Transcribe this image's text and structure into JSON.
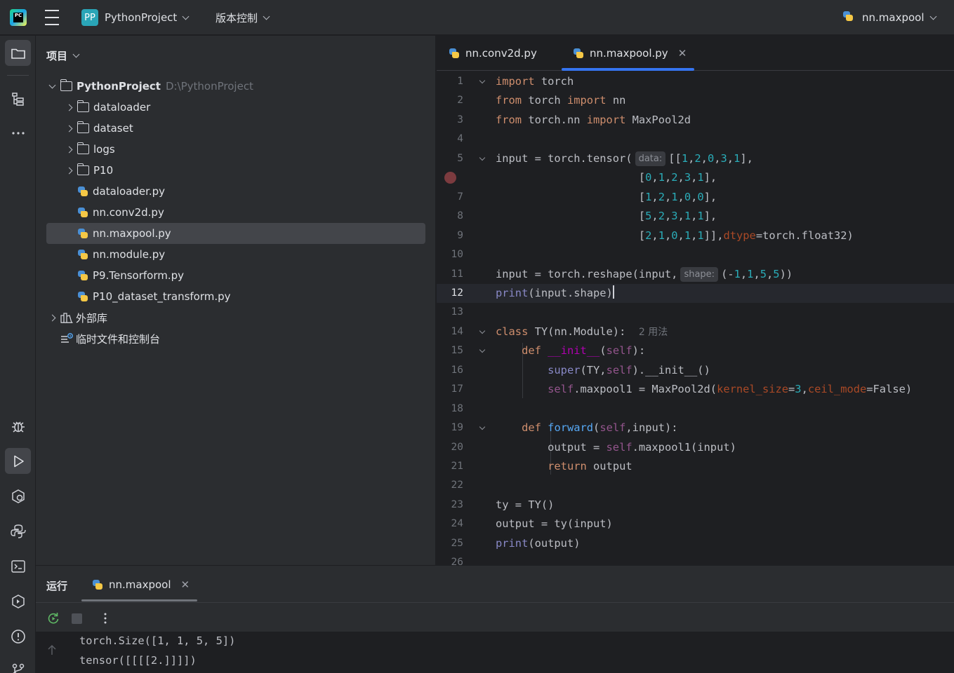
{
  "titlebar": {
    "project_badge": "PP",
    "project_name": "PythonProject",
    "vcs_label": "版本控制",
    "run_config": "nn.maxpool"
  },
  "left_strip": {
    "top_icons": [
      "folder-icon",
      "structure-icon",
      "more-icon"
    ],
    "bottom_icons": [
      "debug-icon",
      "run-icon",
      "services-icon",
      "python-packages-icon",
      "terminal-icon",
      "deploy-icon",
      "problems-icon",
      "git-icon"
    ]
  },
  "project_panel": {
    "title": "项目",
    "root": {
      "name": "PythonProject",
      "path": "D:\\PythonProject"
    },
    "items": [
      {
        "type": "folder",
        "label": "dataloader"
      },
      {
        "type": "folder",
        "label": "dataset"
      },
      {
        "type": "folder",
        "label": "logs"
      },
      {
        "type": "folder",
        "label": "P10"
      },
      {
        "type": "file",
        "label": "dataloader.py"
      },
      {
        "type": "file",
        "label": "nn.conv2d.py"
      },
      {
        "type": "file",
        "label": "nn.maxpool.py",
        "selected": true
      },
      {
        "type": "file",
        "label": "nn.module.py"
      },
      {
        "type": "file",
        "label": "P9.Tensorform.py"
      },
      {
        "type": "file",
        "label": "P10_dataset_transform.py"
      }
    ],
    "external_libs": "外部库",
    "scratches": "临时文件和控制台"
  },
  "editor": {
    "tabs": [
      {
        "label": "nn.conv2d.py",
        "active": false
      },
      {
        "label": "nn.maxpool.py",
        "active": true
      }
    ],
    "current_line": 12,
    "line_numbers": [
      "1",
      "2",
      "3",
      "4",
      "5",
      "6",
      "7",
      "8",
      "9",
      "10",
      "11",
      "12",
      "13",
      "14",
      "15",
      "16",
      "17",
      "18",
      "19",
      "20",
      "21",
      "22",
      "23",
      "24",
      "25",
      "26"
    ],
    "hints": {
      "data": "data:",
      "shape": "shape:"
    },
    "usage_hint": "2 用法",
    "lines": [
      [
        {
          "k": "kw",
          "t": "import"
        },
        {
          "t": " torch"
        }
      ],
      [
        {
          "k": "kw",
          "t": "from"
        },
        {
          "t": " torch "
        },
        {
          "k": "kw",
          "t": "import"
        },
        {
          "t": " nn"
        }
      ],
      [
        {
          "k": "kw",
          "t": "from"
        },
        {
          "t": " torch.nn "
        },
        {
          "k": "kw",
          "t": "import"
        },
        {
          "t": " MaxPool2d"
        }
      ],
      [],
      [
        {
          "t": "input = torch.tensor("
        },
        {
          "k": "hint",
          "t": "data:"
        },
        {
          "t": "[["
        },
        {
          "k": "num",
          "t": "1"
        },
        {
          "t": ","
        },
        {
          "k": "num",
          "t": "2"
        },
        {
          "t": ","
        },
        {
          "k": "num",
          "t": "0"
        },
        {
          "t": ","
        },
        {
          "k": "num",
          "t": "3"
        },
        {
          "t": ","
        },
        {
          "k": "num",
          "t": "1"
        },
        {
          "t": "],"
        }
      ],
      [
        {
          "t": "                      ["
        },
        {
          "k": "num",
          "t": "0"
        },
        {
          "t": ","
        },
        {
          "k": "num",
          "t": "1"
        },
        {
          "t": ","
        },
        {
          "k": "num",
          "t": "2"
        },
        {
          "t": ","
        },
        {
          "k": "num",
          "t": "3"
        },
        {
          "t": ","
        },
        {
          "k": "num",
          "t": "1"
        },
        {
          "t": "],"
        }
      ],
      [
        {
          "t": "                      ["
        },
        {
          "k": "num",
          "t": "1"
        },
        {
          "t": ","
        },
        {
          "k": "num",
          "t": "2"
        },
        {
          "t": ","
        },
        {
          "k": "num",
          "t": "1"
        },
        {
          "t": ","
        },
        {
          "k": "num",
          "t": "0"
        },
        {
          "t": ","
        },
        {
          "k": "num",
          "t": "0"
        },
        {
          "t": "],"
        }
      ],
      [
        {
          "t": "                      ["
        },
        {
          "k": "num",
          "t": "5"
        },
        {
          "t": ","
        },
        {
          "k": "num",
          "t": "2"
        },
        {
          "t": ","
        },
        {
          "k": "num",
          "t": "3"
        },
        {
          "t": ","
        },
        {
          "k": "num",
          "t": "1"
        },
        {
          "t": ","
        },
        {
          "k": "num",
          "t": "1"
        },
        {
          "t": "],"
        }
      ],
      [
        {
          "t": "                      ["
        },
        {
          "k": "num",
          "t": "2"
        },
        {
          "t": ","
        },
        {
          "k": "num",
          "t": "1"
        },
        {
          "t": ","
        },
        {
          "k": "num",
          "t": "0"
        },
        {
          "t": ","
        },
        {
          "k": "num",
          "t": "1"
        },
        {
          "t": ","
        },
        {
          "k": "num",
          "t": "1"
        },
        {
          "t": "]],"
        },
        {
          "k": "param",
          "t": "dtype"
        },
        {
          "t": "=torch.float32)"
        }
      ],
      [],
      [
        {
          "t": "input = torch.reshape(input,"
        },
        {
          "k": "hint",
          "t": "shape:"
        },
        {
          "t": "(-"
        },
        {
          "k": "num",
          "t": "1"
        },
        {
          "t": ","
        },
        {
          "k": "num",
          "t": "1"
        },
        {
          "t": ","
        },
        {
          "k": "num",
          "t": "5"
        },
        {
          "t": ","
        },
        {
          "k": "num",
          "t": "5"
        },
        {
          "t": "))"
        }
      ],
      [
        {
          "k": "bi",
          "t": "print"
        },
        {
          "t": "(input.shape)"
        },
        {
          "k": "caret",
          "t": ""
        }
      ],
      [],
      [
        {
          "k": "kw",
          "t": "class"
        },
        {
          "t": " TY(nn.Module):  "
        },
        {
          "k": "usage",
          "t": "2 用法"
        }
      ],
      [
        {
          "t": "    "
        },
        {
          "k": "kw",
          "t": "def"
        },
        {
          "t": " "
        },
        {
          "k": "dunder",
          "t": "__init__"
        },
        {
          "t": "("
        },
        {
          "k": "self",
          "t": "self"
        },
        {
          "t": "):"
        }
      ],
      [
        {
          "t": "        "
        },
        {
          "k": "bi",
          "t": "super"
        },
        {
          "t": "(TY,"
        },
        {
          "k": "self",
          "t": "self"
        },
        {
          "t": ").__init__()"
        }
      ],
      [
        {
          "t": "        "
        },
        {
          "k": "self",
          "t": "self"
        },
        {
          "t": ".maxpool1 = MaxPool2d("
        },
        {
          "k": "param",
          "t": "kernel_size"
        },
        {
          "t": "="
        },
        {
          "k": "num",
          "t": "3"
        },
        {
          "t": ","
        },
        {
          "k": "param",
          "t": "ceil_mode"
        },
        {
          "t": "=False)"
        }
      ],
      [],
      [
        {
          "t": "    "
        },
        {
          "k": "kw",
          "t": "def"
        },
        {
          "t": " "
        },
        {
          "k": "fn",
          "t": "forward"
        },
        {
          "t": "("
        },
        {
          "k": "self",
          "t": "self"
        },
        {
          "t": ",input):"
        }
      ],
      [
        {
          "t": "        output = "
        },
        {
          "k": "self",
          "t": "self"
        },
        {
          "t": ".maxpool1(input)"
        }
      ],
      [
        {
          "t": "        "
        },
        {
          "k": "kw",
          "t": "return"
        },
        {
          "t": " output"
        }
      ],
      [],
      [
        {
          "t": "ty = TY()"
        }
      ],
      [
        {
          "t": "output = ty(input)"
        }
      ],
      [
        {
          "k": "bi",
          "t": "print"
        },
        {
          "t": "(output)"
        }
      ],
      []
    ]
  },
  "run_panel": {
    "title": "运行",
    "tab_label": "nn.maxpool",
    "output": [
      "torch.Size([1, 1, 5, 5])",
      "tensor([[[[2.]]]])"
    ]
  },
  "colors": {
    "accent": "#3574f0",
    "keyword": "#cf8e6d",
    "number": "#2aacb8",
    "function": "#56a8f5",
    "builtin": "#8888c6",
    "self": "#94558d",
    "param": "#aa4926",
    "breakpoint": "#7c3b3f"
  }
}
